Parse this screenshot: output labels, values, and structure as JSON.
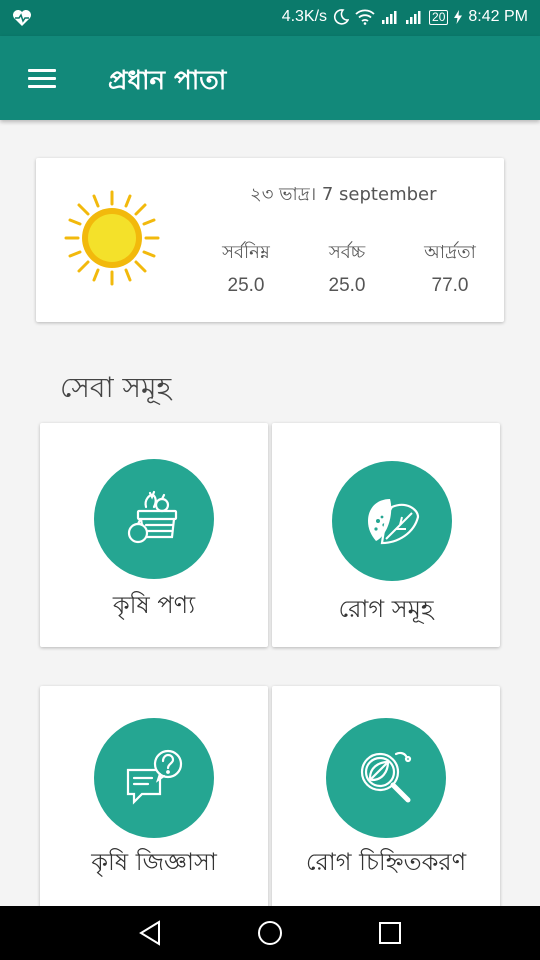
{
  "status_bar": {
    "network_speed": "4.3K/s",
    "battery": "20",
    "time": "8:42 PM"
  },
  "app_bar": {
    "title": "প্রধান পাতা"
  },
  "weather": {
    "date": "২৩ ভাদ্র। 7 september",
    "stats": [
      {
        "label": "সর্বনিম্ন",
        "value": "25.0"
      },
      {
        "label": "সর্বচ্চ",
        "value": "25.0"
      },
      {
        "label": "আর্দ্রতা",
        "value": "77.0"
      }
    ]
  },
  "services": {
    "title": "সেবা সমূহ",
    "items": [
      {
        "label": "কৃষি পণ্য",
        "icon": "vegetable-basket-icon"
      },
      {
        "label": "রোগ সমূহ",
        "icon": "diseased-leaf-icon"
      },
      {
        "label": "কৃষি জিজ্ঞাসা",
        "icon": "question-chat-icon"
      },
      {
        "label": "রোগ চিহ্নিতকরণ",
        "icon": "leaf-magnifier-icon"
      }
    ]
  },
  "colors": {
    "status_bar": "#0b7a6b",
    "app_bar": "#12897a",
    "accent_circle": "#25a692",
    "sun": "#f2b90c"
  }
}
